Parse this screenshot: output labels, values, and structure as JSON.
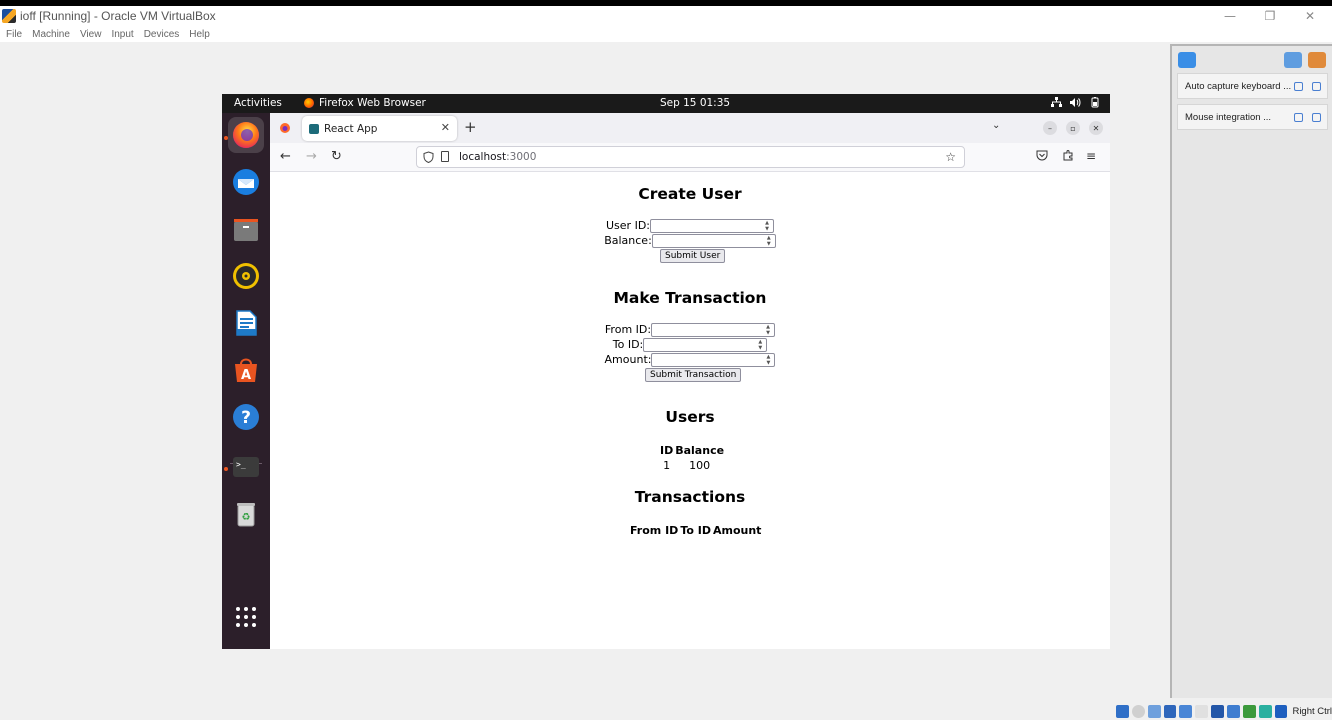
{
  "virtualbox": {
    "title": "ioff [Running] - Oracle VM VirtualBox",
    "window_controls": {
      "minimize": "—",
      "restore": "❐",
      "close": "✕"
    },
    "menu": [
      "File",
      "Machine",
      "View",
      "Input",
      "Devices",
      "Help"
    ],
    "notifications": [
      "Auto capture keyboard ...",
      "Mouse integration ..."
    ],
    "host_key_label": "Right Ctrl"
  },
  "gnome": {
    "activities": "Activities",
    "app_name": "Firefox Web Browser",
    "clock": "Sep 15  01:35",
    "status_icons": [
      "network-icon",
      "volume-icon",
      "battery-icon"
    ],
    "dock_items": [
      "firefox",
      "thunderbird",
      "files",
      "rhythmbox",
      "libreoffice-writer",
      "software-center",
      "help",
      "terminal",
      "trash",
      "show-apps"
    ]
  },
  "firefox": {
    "tab_title": "React App",
    "tab_close": "✕",
    "new_tab": "+",
    "url_host": "localhost",
    "url_port": ":3000"
  },
  "page": {
    "create_user": {
      "heading": "Create User",
      "user_id_label": "User ID:",
      "balance_label": "Balance:",
      "submit_label": "Submit User"
    },
    "make_transaction": {
      "heading": "Make Transaction",
      "from_id_label": "From ID:",
      "to_id_label": "To ID:",
      "amount_label": "Amount:",
      "submit_label": "Submit Transaction"
    },
    "users": {
      "heading": "Users",
      "columns": [
        "ID",
        "Balance"
      ],
      "rows": [
        [
          "1",
          "100"
        ]
      ]
    },
    "transactions": {
      "heading": "Transactions",
      "columns": [
        "From ID",
        "To ID",
        "Amount"
      ],
      "rows": []
    }
  }
}
